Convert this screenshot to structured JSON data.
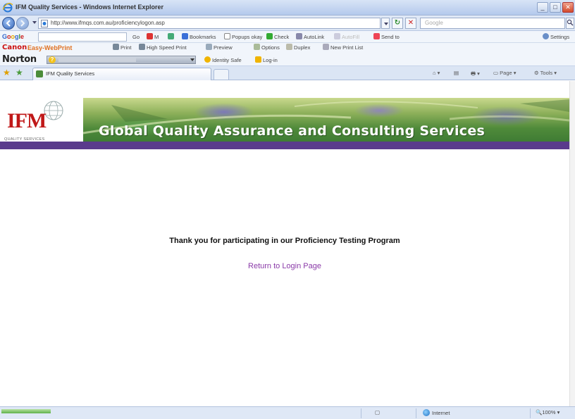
{
  "window": {
    "title": "IFM Quality Services - Windows Internet Explorer"
  },
  "addressbar": {
    "url": "http://www.ifmqs.com.au/proficiencylogon.asp",
    "search_placeholder": "Google"
  },
  "google_toolbar": {
    "logo": "Google",
    "items": {
      "go": "Go",
      "bookmarks": "Bookmarks",
      "popups": "Popups okay",
      "check": "Check",
      "autolink": "AutoLink",
      "autofill": "AutoFill",
      "sendto": "Send to",
      "settings": "Settings"
    }
  },
  "canon_toolbar": {
    "brand": "Canon",
    "product": "Easy-WebPrint",
    "items": {
      "print": "Print",
      "high_speed_print": "High Speed Print",
      "preview": "Preview",
      "options": "Options",
      "duplex": "Duplex",
      "new_print_list": "New Print List"
    }
  },
  "norton_toolbar": {
    "brand": "Norton",
    "identity_safe": "Identity Safe",
    "log_in": "Log-in"
  },
  "tabs": {
    "active_tab": "IFM Quality Services",
    "commands": {
      "page": "Page",
      "tools": "Tools"
    }
  },
  "page": {
    "banner_title": "Global Quality Assurance and Consulting Services",
    "logo_text": "IFM",
    "logo_subtitle": "QUALITY SERVICES",
    "thanks_message": "Thank you for participating in our Proficiency Testing Program",
    "return_link": "Return to Login Page"
  },
  "statusbar": {
    "zone": "Internet",
    "zoom": "100%"
  },
  "colors": {
    "banner_stripe": "#5a3b8c",
    "logo_red": "#c01818",
    "link_purple": "#8a3aa8"
  }
}
